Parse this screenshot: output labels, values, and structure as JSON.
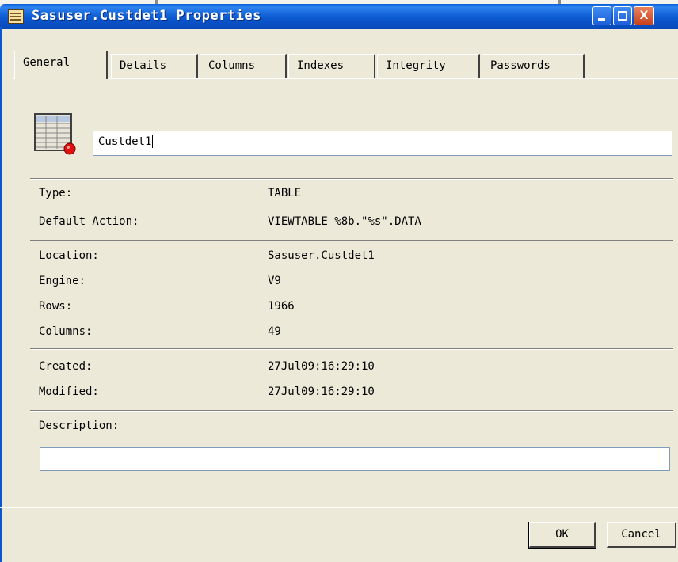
{
  "window": {
    "title": "Sasuser.Custdet1 Properties",
    "buttons": {
      "minimize": "minimize",
      "maximize": "maximize",
      "close": "X"
    }
  },
  "tabs": [
    {
      "label": "General",
      "active": true
    },
    {
      "label": "Details"
    },
    {
      "label": "Columns"
    },
    {
      "label": "Indexes"
    },
    {
      "label": "Integrity"
    },
    {
      "label": "Passwords"
    }
  ],
  "general": {
    "name_value": "Custdet1",
    "type": {
      "label": "Type:",
      "value": "TABLE"
    },
    "default_action": {
      "label": "Default Action:",
      "value": "VIEWTABLE %8b.\"%s\".DATA"
    },
    "location": {
      "label": "Location:",
      "value": "Sasuser.Custdet1"
    },
    "engine": {
      "label": "Engine:",
      "value": "V9"
    },
    "rows": {
      "label": "Rows:",
      "value": "1966"
    },
    "columns": {
      "label": "Columns:",
      "value": "49"
    },
    "created": {
      "label": "Created:",
      "value": "27Jul09:16:29:10"
    },
    "modified": {
      "label": "Modified:",
      "value": "27Jul09:16:29:10"
    },
    "description": {
      "label": "Description:",
      "value": ""
    }
  },
  "footer": {
    "ok_label": "OK",
    "cancel_label": "Cancel"
  },
  "colors": {
    "titlebar": "#0b58d0",
    "dialog_bg": "#ece9d8",
    "close_button": "#c7431f"
  }
}
